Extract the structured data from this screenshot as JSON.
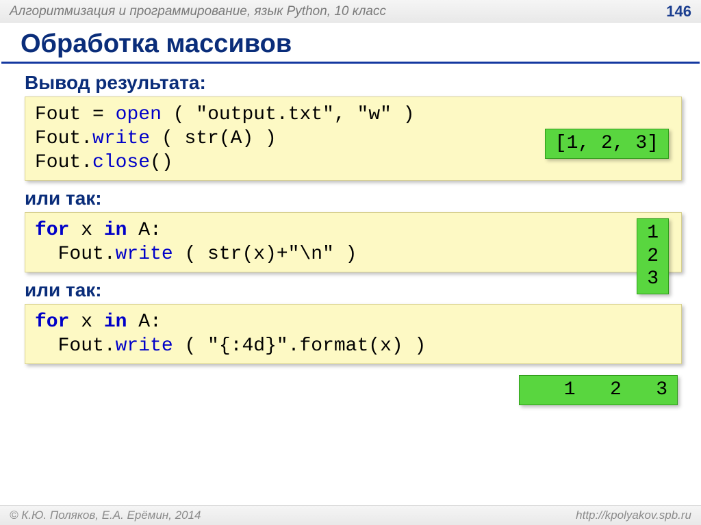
{
  "header": {
    "subject": "Алгоритмизация и программирование, язык Python, 10 класс",
    "page": "146"
  },
  "title": "Обработка массивов",
  "sections": {
    "s1_label": "Вывод результата:",
    "s2_label": "или так:",
    "s3_label": "или так:"
  },
  "code1": {
    "l1a": "Fout",
    "l1b": "=",
    "l1c": "open",
    "l1d": " ( \"output.txt\", \"w\" )",
    "l2a": "Fout.",
    "l2b": "write",
    "l2c": " ( str(A) )",
    "l3a": "Fout.",
    "l3b": "close",
    "l3c": "()"
  },
  "out1": "[1, 2, 3]",
  "code2": {
    "l1a": "for",
    "l1b": " x ",
    "l1c": "in",
    "l1d": " A:",
    "l2a": "  Fout.",
    "l2b": "write",
    "l2c": " ( str(x)+\"\\n\" )"
  },
  "out2": "1\n2\n3",
  "code3": {
    "l1a": "for",
    "l1b": " x ",
    "l1c": "in",
    "l1d": " A:",
    "l2a": "  Fout.",
    "l2b": "write",
    "l2c": " ( \"{:4d}\".format(x) )"
  },
  "out3": "   1   2   3",
  "footer": {
    "left": "© К.Ю. Поляков, Е.А. Ерёмин, 2014",
    "right": "http://kpolyakov.spb.ru"
  }
}
